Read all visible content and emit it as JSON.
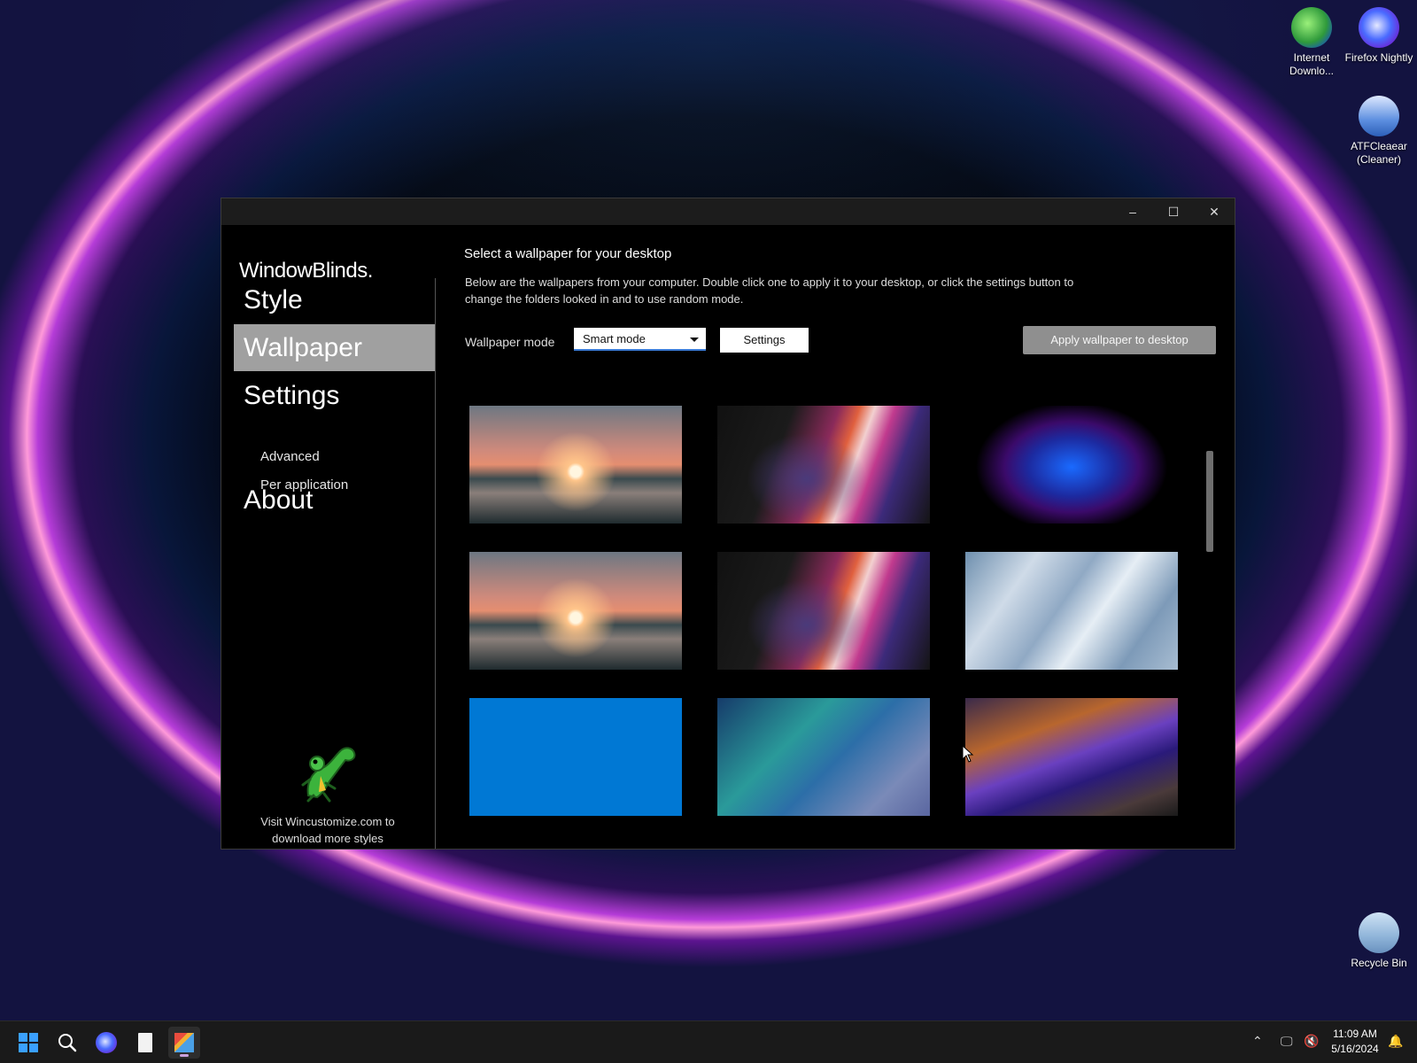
{
  "desktop": {
    "icons": [
      {
        "label": "Internet Downlo...",
        "icon": "idm-icon"
      },
      {
        "label": "Firefox Nightly",
        "icon": "firefox-nightly-icon"
      },
      {
        "label": "ATFCleaear (Cleaner)",
        "icon": "atf-cleaner-icon"
      },
      {
        "label": "Recycle Bin",
        "icon": "recycle-bin-icon"
      }
    ]
  },
  "window": {
    "controls": {
      "minimize": "–",
      "maximize": "☐",
      "close": "✕"
    },
    "brand": "WindowBlinds.",
    "nav": {
      "style": "Style",
      "wallpaper": "Wallpaper",
      "settings": "Settings",
      "advanced": "Advanced",
      "per_application": "Per application",
      "about": "About"
    },
    "promo": "Visit Wincustomize.com to download more styles",
    "content": {
      "heading": "Select a wallpaper for your desktop",
      "description": "Below are the wallpapers from your computer.  Double click one to apply it to your desktop, or click the settings button to change the folders looked in and to use random mode.",
      "mode_label": "Wallpaper mode",
      "mode_value": "Smart mode",
      "settings_button": "Settings",
      "apply_button": "Apply wallpaper to desktop"
    },
    "wallpapers": [
      "sunset-lake",
      "purple-ribbon",
      "blue-bloom",
      "sunset-lake",
      "purple-ribbon",
      "silver-flow",
      "solid-blue",
      "teal-fabric",
      "abstract-waves"
    ]
  },
  "taskbar": {
    "time": "11:09 AM",
    "date": "5/16/2024",
    "icons": [
      "start-icon",
      "search-icon",
      "firefox-icon",
      "file-icon",
      "windowblinds-icon"
    ],
    "accent": "#3aa0ff"
  }
}
